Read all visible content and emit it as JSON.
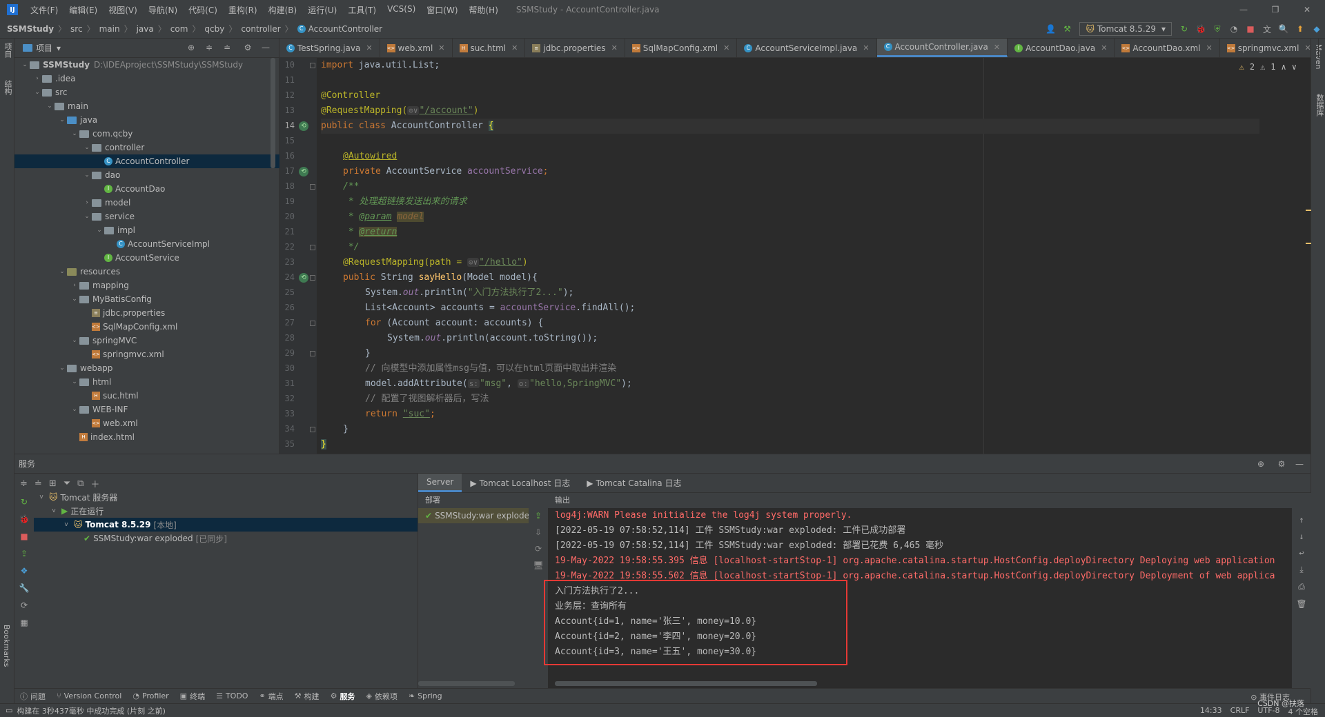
{
  "app": {
    "window_title": "SSMStudy - AccountController.java"
  },
  "menu": [
    "文件(F)",
    "编辑(E)",
    "视图(V)",
    "导航(N)",
    "代码(C)",
    "重构(R)",
    "构建(B)",
    "运行(U)",
    "工具(T)",
    "VCS(S)",
    "窗口(W)",
    "帮助(H)"
  ],
  "breadcrumbs": [
    "SSMStudy",
    "src",
    "main",
    "java",
    "com",
    "qcby",
    "controller",
    "AccountController"
  ],
  "run_config": "Tomcat 8.5.29",
  "project_panel": {
    "title": "项目",
    "tree": [
      {
        "label": "SSMStudy",
        "path": "D:\\IDEAproject\\SSMStudy\\SSMStudy",
        "indent": 0,
        "arrow": "v",
        "icon": "folder-icon"
      },
      {
        "label": ".idea",
        "indent": 1,
        "arrow": ">",
        "icon": "folder-icon"
      },
      {
        "label": "src",
        "indent": 1,
        "arrow": "v",
        "icon": "folder-icon"
      },
      {
        "label": "main",
        "indent": 2,
        "arrow": "v",
        "icon": "folder-icon"
      },
      {
        "label": "java",
        "indent": 3,
        "arrow": "v",
        "icon": "source-folder-icon"
      },
      {
        "label": "com.qcby",
        "indent": 4,
        "arrow": "v",
        "icon": "folder-icon"
      },
      {
        "label": "controller",
        "indent": 5,
        "arrow": "v",
        "icon": "folder-icon"
      },
      {
        "label": "AccountController",
        "indent": 6,
        "arrow": "",
        "icon": "class-icon",
        "selected": true
      },
      {
        "label": "dao",
        "indent": 5,
        "arrow": "v",
        "icon": "folder-icon"
      },
      {
        "label": "AccountDao",
        "indent": 6,
        "arrow": "",
        "icon": "interface-icon"
      },
      {
        "label": "model",
        "indent": 5,
        "arrow": ">",
        "icon": "folder-icon"
      },
      {
        "label": "service",
        "indent": 5,
        "arrow": "v",
        "icon": "folder-icon"
      },
      {
        "label": "impl",
        "indent": 6,
        "arrow": "v",
        "icon": "folder-icon"
      },
      {
        "label": "AccountServiceImpl",
        "indent": 7,
        "arrow": "",
        "icon": "class-icon"
      },
      {
        "label": "AccountService",
        "indent": 6,
        "arrow": "",
        "icon": "interface-icon"
      },
      {
        "label": "resources",
        "indent": 3,
        "arrow": "v",
        "icon": "resources-folder-icon"
      },
      {
        "label": "mapping",
        "indent": 4,
        "arrow": ">",
        "icon": "folder-icon"
      },
      {
        "label": "MyBatisConfig",
        "indent": 4,
        "arrow": "v",
        "icon": "folder-icon"
      },
      {
        "label": "jdbc.properties",
        "indent": 5,
        "arrow": "",
        "icon": "properties-file-icon"
      },
      {
        "label": "SqlMapConfig.xml",
        "indent": 5,
        "arrow": "",
        "icon": "xml-file-icon"
      },
      {
        "label": "springMVC",
        "indent": 4,
        "arrow": "v",
        "icon": "folder-icon"
      },
      {
        "label": "springmvc.xml",
        "indent": 5,
        "arrow": "",
        "icon": "xml-file-icon"
      },
      {
        "label": "webapp",
        "indent": 3,
        "arrow": "v",
        "icon": "folder-icon"
      },
      {
        "label": "html",
        "indent": 4,
        "arrow": "v",
        "icon": "folder-icon"
      },
      {
        "label": "suc.html",
        "indent": 5,
        "arrow": "",
        "icon": "html-file-icon"
      },
      {
        "label": "WEB-INF",
        "indent": 4,
        "arrow": "v",
        "icon": "folder-icon"
      },
      {
        "label": "web.xml",
        "indent": 5,
        "arrow": "",
        "icon": "xml-file-icon"
      },
      {
        "label": "index.html",
        "indent": 4,
        "arrow": "",
        "icon": "html-file-icon"
      }
    ]
  },
  "tabs": [
    {
      "label": "TestSpring.java",
      "icon": "class-icon"
    },
    {
      "label": "web.xml",
      "icon": "xml-file-icon"
    },
    {
      "label": "suc.html",
      "icon": "html-file-icon"
    },
    {
      "label": "jdbc.properties",
      "icon": "properties-file-icon"
    },
    {
      "label": "SqlMapConfig.xml",
      "icon": "xml-file-icon"
    },
    {
      "label": "AccountServiceImpl.java",
      "icon": "class-icon"
    },
    {
      "label": "AccountController.java",
      "icon": "class-icon",
      "active": true
    },
    {
      "label": "AccountDao.java",
      "icon": "interface-icon"
    },
    {
      "label": "AccountDao.xml",
      "icon": "xml-file-icon"
    },
    {
      "label": "springmvc.xml",
      "icon": "xml-file-icon"
    }
  ],
  "editor": {
    "warnings": "2",
    "weak_warnings": "1",
    "line_numbers": [
      "10",
      "11",
      "12",
      "13",
      "14",
      "15",
      "16",
      "17",
      "18",
      "19",
      "20",
      "21",
      "22",
      "23",
      "24",
      "25",
      "26",
      "27",
      "28",
      "29",
      "30",
      "31",
      "32",
      "33",
      "34",
      "35"
    ],
    "code": {
      "l10_kw": "import",
      "l10_rest": " java.util.List;",
      "l12": "@Controller",
      "l13_a": "@RequestMapping(",
      "l13_hint": "⊙∨",
      "l13_str": "\"/account\"",
      "l13_end": ")",
      "l14_kw": "public class",
      "l14_name": " AccountController ",
      "l14_brace": "{",
      "l16": "@Autowired",
      "l17_kw": "private",
      "l17_type": " AccountService ",
      "l17_field": "accountService",
      "l17_end": ";",
      "l18": "/**",
      "l19": " * 处理超链接发送出来的请求",
      "l20_a": " * ",
      "l20_tag": "@param",
      "l20_sp": " ",
      "l20_param": "model",
      "l21_a": " * ",
      "l21_tag": "@return",
      "l22": " */",
      "l23_a": "@RequestMapping(path = ",
      "l23_hint": "⊙∨",
      "l23_str": "\"/hello\"",
      "l23_end": ")",
      "l24_kw": "public",
      "l24_type": " String ",
      "l24_fn": "sayHello",
      "l24_rest": "(Model model){",
      "l25_a": "System.",
      "l25_out": "out",
      "l25_b": ".println(",
      "l25_str": "\"入门方法执行了2...\"",
      "l25_end": ");",
      "l26_a": "List<Account> accounts = ",
      "l26_field": "accountService",
      "l26_b": ".findAll();",
      "l27_kw": "for",
      "l27_rest": " (Account account: accounts) {",
      "l28_a": "System.",
      "l28_out": "out",
      "l28_b": ".println(account.toString());",
      "l29": "}",
      "l30": "// 向模型中添加属性msg与值，可以在html页面中取出并渲染",
      "l31_a": "model.addAttribute(",
      "l31_h1": "s:",
      "l31_s1": "\"msg\"",
      "l31_c": ", ",
      "l31_h2": "o:",
      "l31_s2": "\"hello,SpringMVC\"",
      "l31_end": ");",
      "l32": "// 配置了视图解析器后，写法",
      "l33_kw": "return",
      "l33_str": "\"suc\"",
      "l33_end": ";",
      "l34": "}",
      "l35": "}"
    }
  },
  "services": {
    "title": "服务",
    "tree": {
      "root": "Tomcat 服务器",
      "running": "正在运行",
      "server": "Tomcat 8.5.29",
      "server_tag": "[本地]",
      "artifact": "SSMStudy:war exploded",
      "artifact_tag": "[已同步]"
    },
    "tabs": [
      "Server",
      "Tomcat Localhost 日志",
      "Tomcat Catalina 日志"
    ],
    "deploy_header": "部署",
    "deploy_item": "SSMStudy:war exploded",
    "output_header": "输出",
    "output_lines": [
      {
        "text": "log4j:WARN Please initialize the log4j system properly.",
        "red": true
      },
      {
        "text": "[2022-05-19 07:58:52,114] 工件 SSMStudy:war exploded: 工件已成功部署",
        "red": false
      },
      {
        "text": "[2022-05-19 07:58:52,114] 工件 SSMStudy:war exploded: 部署已花费 6,465 毫秒",
        "red": false
      },
      {
        "text": "19-May-2022 19:58:55.395 信息 [localhost-startStop-1] org.apache.catalina.startup.HostConfig.deployDirectory Deploying web application",
        "red": true
      },
      {
        "text": "19-May-2022 19:58:55.502 信息 [localhost-startStop-1] org.apache.catalina.startup.HostConfig.deployDirectory Deployment of web applica",
        "red": true
      },
      {
        "text": "入门方法执行了2...",
        "red": false
      },
      {
        "text": "业务层：查询所有",
        "red": false
      },
      {
        "text": "Account{id=1, name='张三', money=10.0}",
        "red": false
      },
      {
        "text": "Account{id=2, name='李四', money=20.0}",
        "red": false
      },
      {
        "text": "Account{id=3, name='王五', money=30.0}",
        "red": false
      }
    ]
  },
  "bottom_tabs": [
    {
      "label": "问题",
      "icon": "problems-icon"
    },
    {
      "label": "Version Control",
      "icon": "vcs-icon"
    },
    {
      "label": "Profiler",
      "icon": "profiler-icon"
    },
    {
      "label": "终端",
      "icon": "terminal-icon"
    },
    {
      "label": "TODO",
      "icon": "todo-icon"
    },
    {
      "label": "端点",
      "icon": "endpoints-icon"
    },
    {
      "label": "构建",
      "icon": "build-icon"
    },
    {
      "label": "服务",
      "icon": "services-icon",
      "active": true
    },
    {
      "label": "依赖项",
      "icon": "dependencies-icon"
    },
    {
      "label": "Spring",
      "icon": "spring-icon"
    }
  ],
  "event_log": "事件日志",
  "status": {
    "message": "构建在 3秒437毫秒 中成功完成 (片刻 之前)",
    "position": "14:33",
    "line_sep": "CRLF",
    "encoding": "UTF-8",
    "indent": "4 个空格",
    "watermark": "CSDN @扶落"
  },
  "strips": {
    "left_top": "项目",
    "left_mid": "结构",
    "left_bottom": "Bookmarks",
    "right_top": "Maven",
    "right_mid": "数据库"
  }
}
